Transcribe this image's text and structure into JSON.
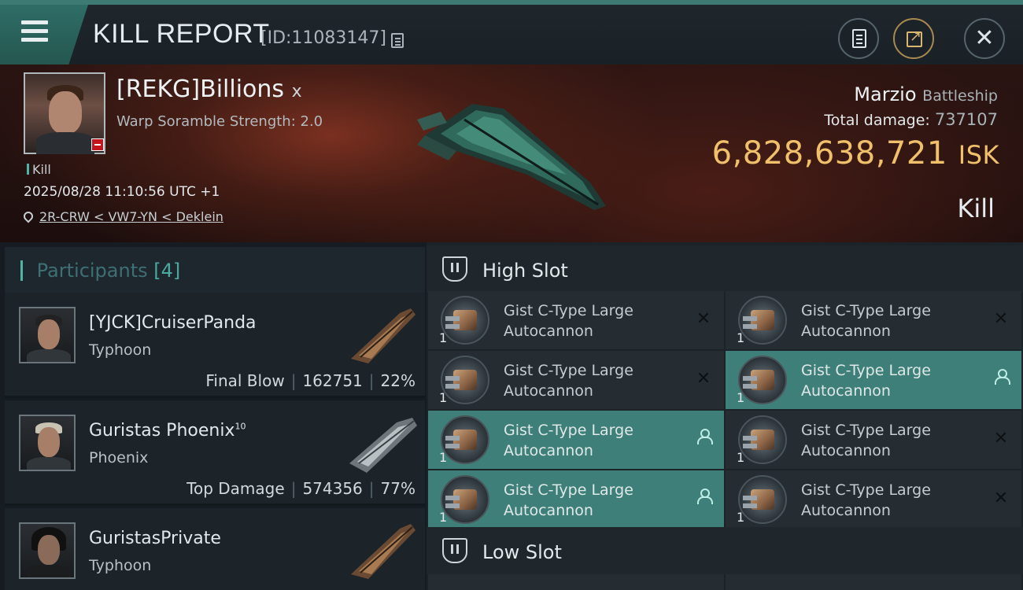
{
  "header": {
    "title": "KILL REPORT",
    "report_id": "[ID:11083147]"
  },
  "victim": {
    "name": "[REKG]Billions",
    "name_suffix": "x",
    "warp_scramble": "Warp Soramble Strength: 2.0",
    "kill_tag": "Kill",
    "datetime": "2025/08/28 11:10:56 UTC +1",
    "location": "2R-CRW < VW7-YN < Deklein",
    "pilot": "Marzio",
    "ship_class": "Battleship",
    "total_damage_label": "Total damage:",
    "total_damage": "737107",
    "isk_value": "6,828,638,721",
    "isk_unit": "ISK",
    "status": "Kill"
  },
  "participants": {
    "label": "Participants",
    "count": "[4]",
    "rows": [
      {
        "name": "[YJCK]CruiserPanda",
        "sup": "",
        "ship": "Typhoon",
        "role": "Final Blow",
        "damage": "162751",
        "percent": "22%"
      },
      {
        "name": "Guristas Phoenix",
        "sup": "10",
        "ship": "Phoenix",
        "role": "Top Damage",
        "damage": "574356",
        "percent": "77%"
      },
      {
        "name": "GuristasPrivate",
        "sup": "",
        "ship": "Typhoon",
        "role": "",
        "damage": "",
        "percent": ""
      }
    ]
  },
  "slots": {
    "high_label": "High Slot",
    "low_label": "Low Slot",
    "high_modules": [
      {
        "line1": "Gist C-Type Large",
        "line2": "Autocannon",
        "qty": "1",
        "state": "destroyed"
      },
      {
        "line1": "Gist C-Type Large",
        "line2": "Autocannon",
        "qty": "1",
        "state": "destroyed"
      },
      {
        "line1": "Gist C-Type Large",
        "line2": "Autocannon",
        "qty": "1",
        "state": "destroyed"
      },
      {
        "line1": "Gist C-Type Large",
        "line2": "Autocannon",
        "qty": "1",
        "state": "dropped"
      },
      {
        "line1": "Gist C-Type Large",
        "line2": "Autocannon",
        "qty": "1",
        "state": "dropped"
      },
      {
        "line1": "Gist C-Type Large",
        "line2": "Autocannon",
        "qty": "1",
        "state": "destroyed"
      },
      {
        "line1": "Gist C-Type Large",
        "line2": "Autocannon",
        "qty": "1",
        "state": "dropped"
      },
      {
        "line1": "Gist C-Type Large",
        "line2": "Autocannon",
        "qty": "1",
        "state": "destroyed"
      }
    ],
    "status_glyph": "✕"
  },
  "colors": {
    "accent_teal": "#3f7f79",
    "isk_gold": "#f0c06b",
    "header_top": "#3c7a73"
  },
  "icons": [
    "menu-icon",
    "copy-icon",
    "clipboard-icon",
    "share-icon",
    "close-icon",
    "location-pin-icon",
    "high-slot-icon",
    "low-slot-icon",
    "destroyed-icon",
    "dropped-icon"
  ]
}
